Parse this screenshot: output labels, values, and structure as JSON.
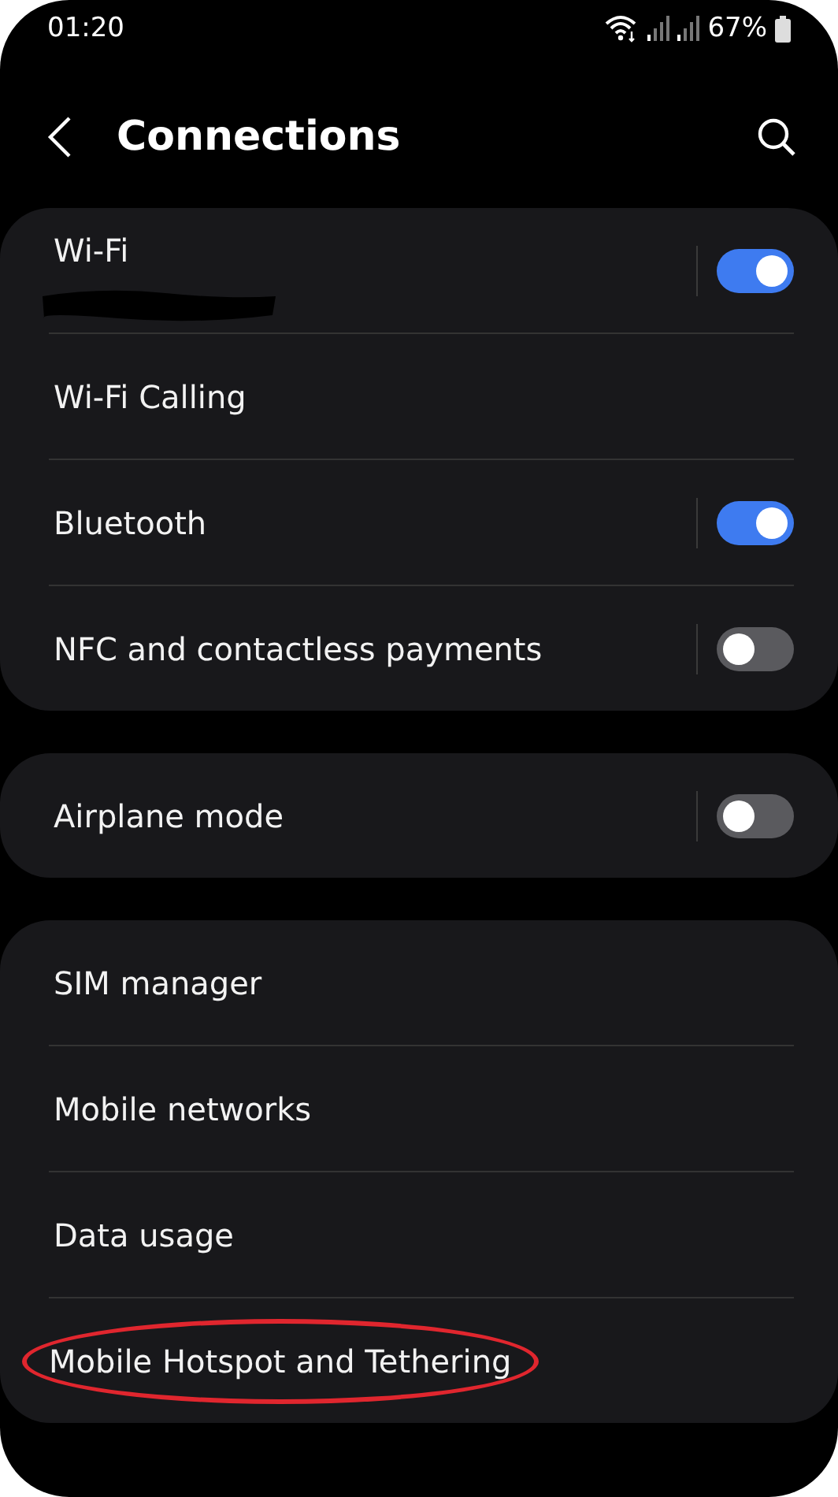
{
  "status_bar": {
    "time": "01:20",
    "battery": "67%"
  },
  "header": {
    "title": "Connections"
  },
  "groups": [
    {
      "items": [
        {
          "label": "Wi-Fi",
          "kind": "toggle",
          "on": true,
          "subtitle_redacted": true,
          "highlighted": false
        },
        {
          "label": "Wi-Fi Calling",
          "kind": "link",
          "subtitle_redacted": false,
          "highlighted": false
        },
        {
          "label": "Bluetooth",
          "kind": "toggle",
          "on": true,
          "subtitle_redacted": false,
          "highlighted": false
        },
        {
          "label": "NFC and contactless payments",
          "kind": "toggle",
          "on": false,
          "subtitle_redacted": false,
          "highlighted": false
        }
      ]
    },
    {
      "items": [
        {
          "label": "Airplane mode",
          "kind": "toggle",
          "on": false,
          "subtitle_redacted": false,
          "highlighted": false
        }
      ]
    },
    {
      "items": [
        {
          "label": "SIM manager",
          "kind": "link",
          "subtitle_redacted": false,
          "highlighted": false
        },
        {
          "label": "Mobile networks",
          "kind": "link",
          "subtitle_redacted": false,
          "highlighted": false
        },
        {
          "label": "Data usage",
          "kind": "link",
          "subtitle_redacted": false,
          "highlighted": false
        },
        {
          "label": "Mobile Hotspot and Tethering",
          "kind": "link",
          "subtitle_redacted": false,
          "highlighted": true
        }
      ]
    }
  ]
}
